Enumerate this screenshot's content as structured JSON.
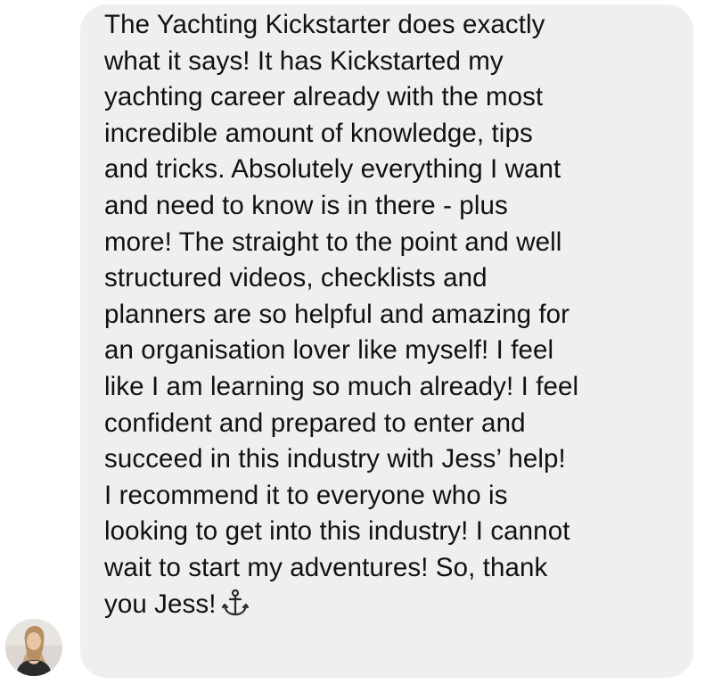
{
  "conversation": {
    "sender": {
      "avatar_icon": "profile-photo-avatar"
    },
    "message": {
      "lines": [
        "The Yachting Kickstarter does exactly",
        "what it says! It has Kickstarted my",
        "yachting career already with the most",
        "incredible amount of knowledge, tips",
        "and tricks. Absolutely everything I want",
        "and need to know is in there - plus",
        "more! The straight to the point and well",
        "structured videos, checklists and",
        "planners are so helpful and amazing for",
        "an organisation lover like myself! I feel",
        "like I am learning so much already! I feel",
        "confident and prepared to enter and",
        "succeed in this industry with Jess’ help!",
        "I recommend it to everyone who is",
        "looking to get into this industry! I cannot",
        "wait to start my adventures! So, thank",
        "you Jess!"
      ],
      "trailing_icon": "anchor-icon"
    },
    "colors": {
      "bubble_background": "#efefef",
      "text": "#111111",
      "page_background": "#ffffff"
    }
  }
}
